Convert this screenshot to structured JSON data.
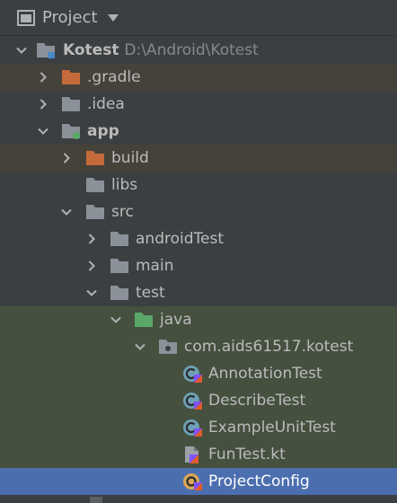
{
  "header": {
    "title": "Project"
  },
  "tree": [
    {
      "name": "Kotest",
      "path": "D:\\Android\\Kotest",
      "icon": "module-folder-icon",
      "expanded": true
    },
    {
      "name": ".gradle",
      "icon": "excluded-folder-icon",
      "expanded": false
    },
    {
      "name": ".idea",
      "icon": "folder-icon",
      "expanded": false
    },
    {
      "name": "app",
      "icon": "android-module-icon",
      "expanded": true
    },
    {
      "name": "build",
      "icon": "excluded-folder-icon",
      "expanded": false
    },
    {
      "name": "libs",
      "icon": "folder-icon"
    },
    {
      "name": "src",
      "icon": "folder-icon",
      "expanded": true
    },
    {
      "name": "androidTest",
      "icon": "folder-icon",
      "expanded": false
    },
    {
      "name": "main",
      "icon": "folder-icon",
      "expanded": false
    },
    {
      "name": "test",
      "icon": "folder-icon",
      "expanded": true
    },
    {
      "name": "java",
      "icon": "test-source-folder-icon",
      "expanded": true
    },
    {
      "name": "com.aids61517.kotest",
      "icon": "package-icon",
      "expanded": true
    },
    {
      "name": "AnnotationTest",
      "icon": "kotlin-class-icon"
    },
    {
      "name": "DescribeTest",
      "icon": "kotlin-class-icon"
    },
    {
      "name": "ExampleUnitTest",
      "icon": "kotlin-class-icon"
    },
    {
      "name": "FunTest.kt",
      "icon": "kotlin-file-icon"
    },
    {
      "name": "ProjectConfig",
      "icon": "kotlin-object-icon",
      "selected": true
    }
  ],
  "colors": {
    "background": "#3c3f41",
    "selection": "#4b6eaf",
    "excluded_folder": "#c46a3b",
    "folder": "#8a9199",
    "test_folder": "#59a869",
    "kotlin_class": "#6ea0b6"
  }
}
